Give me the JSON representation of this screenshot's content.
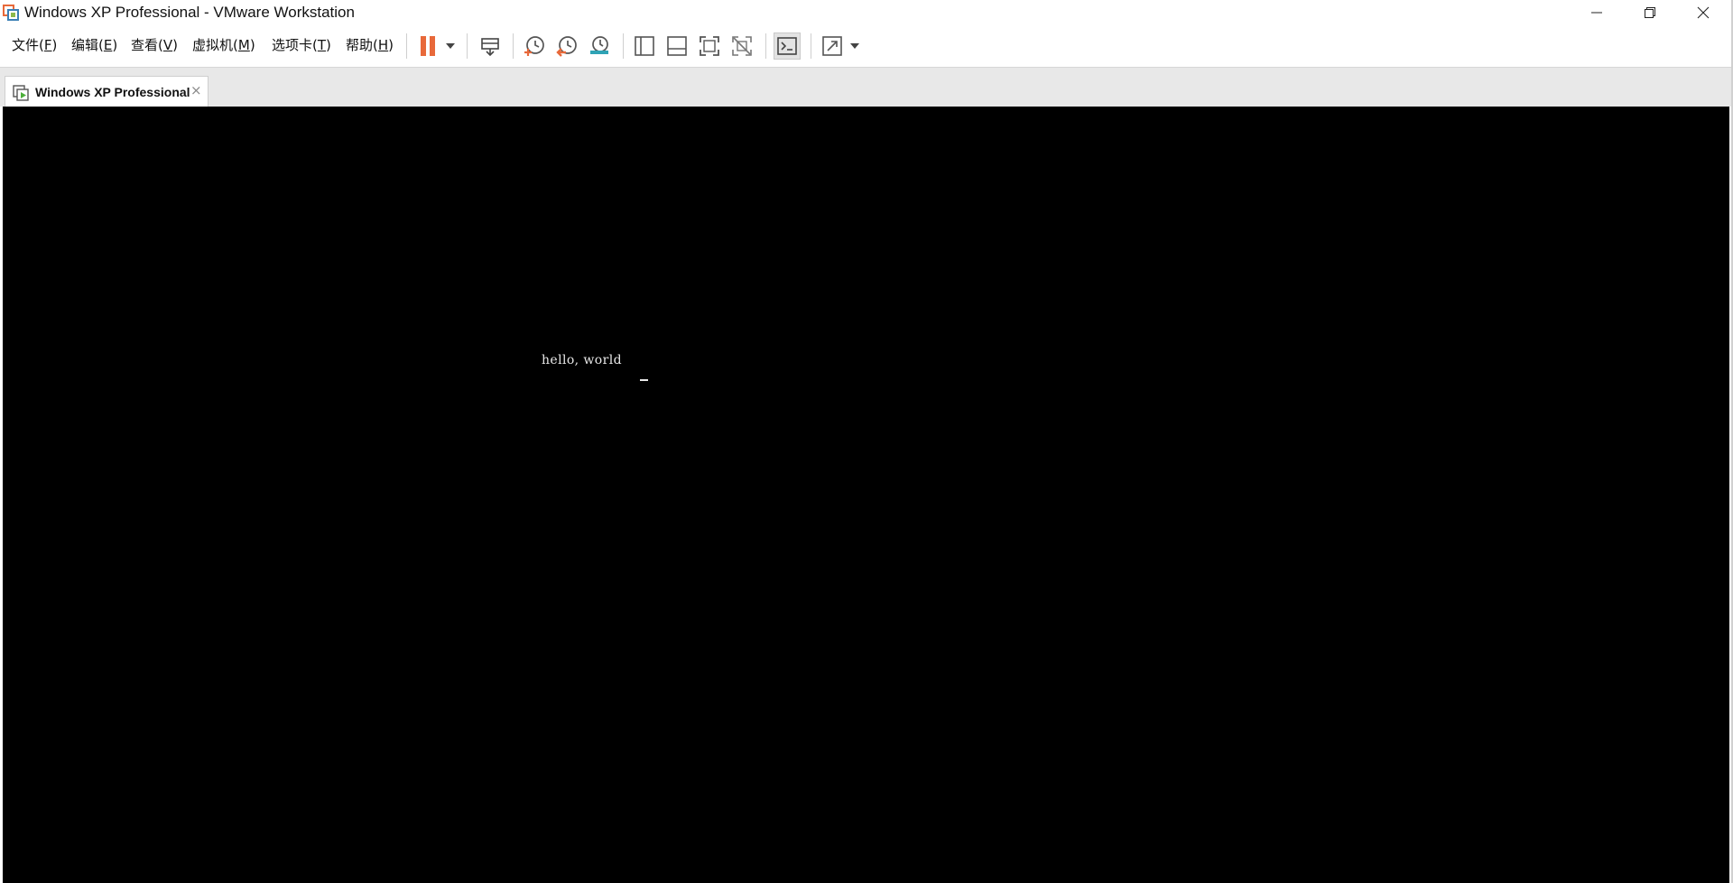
{
  "window": {
    "title": "Windows XP Professional - VMware Workstation"
  },
  "menu": {
    "items": [
      {
        "label": "文件(",
        "key": "F",
        "close": ")"
      },
      {
        "label": "编辑(",
        "key": "E",
        "close": ")"
      },
      {
        "label": "查看(",
        "key": "V",
        "close": ")"
      },
      {
        "label": "虚拟机(",
        "key": "M",
        "close": ")"
      },
      {
        "label": "选项卡(",
        "key": "T",
        "close": ")"
      },
      {
        "label": "帮助(",
        "key": "H",
        "close": ")"
      }
    ]
  },
  "toolbar": {
    "icons": [
      "pause-icon",
      "send-ctrl-alt-del-icon",
      "take-snapshot-icon",
      "revert-snapshot-icon",
      "snapshot-manager-icon",
      "library-view-icon",
      "thumbnail-bar-icon",
      "full-screen-icon",
      "unity-icon",
      "console-view-icon",
      "stretch-guest-icon"
    ],
    "colors": {
      "pause": "#e8693a",
      "snapshot_orange": "#e8693a",
      "snapshot_teal": "#2fa3b5"
    }
  },
  "tabs": [
    {
      "label": "Windows XP Professional",
      "close": "×"
    }
  ],
  "console": {
    "text": "hello, world",
    "background": "#000000",
    "foreground": "#e8e8e8"
  }
}
